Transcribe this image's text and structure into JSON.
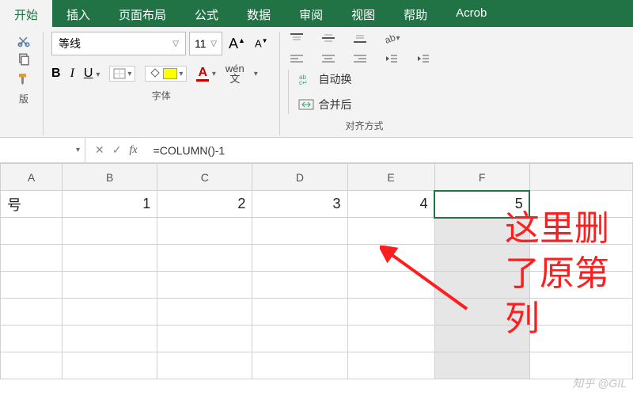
{
  "tabs": [
    "开始",
    "插入",
    "页面布局",
    "公式",
    "数据",
    "审阅",
    "视图",
    "帮助",
    "Acrob"
  ],
  "active_tab": 0,
  "ribbon": {
    "clipboard_label": "版",
    "font": {
      "group_label": "字体",
      "name": "等线",
      "size": "11",
      "bold": "B",
      "italic": "I",
      "underline": "U",
      "font_color_letter": "A",
      "wen_top": "wén",
      "wen_bot": "文"
    },
    "align": {
      "group_label": "对齐方式",
      "wrap": "自动换",
      "merge": "合并后"
    }
  },
  "formula_bar": {
    "name_box": "",
    "fx": "fx",
    "formula": "=COLUMN()-1"
  },
  "grid": {
    "headers": [
      "A",
      "B",
      "C",
      "D",
      "E",
      "F"
    ],
    "row1": {
      "label": "号",
      "cells": [
        "1",
        "2",
        "3",
        "4",
        "5"
      ]
    },
    "selected_col": "F"
  },
  "annotation": {
    "l1": "这里删",
    "l2": "了原第",
    "l3": "列"
  },
  "watermark": "知乎 @GIL"
}
